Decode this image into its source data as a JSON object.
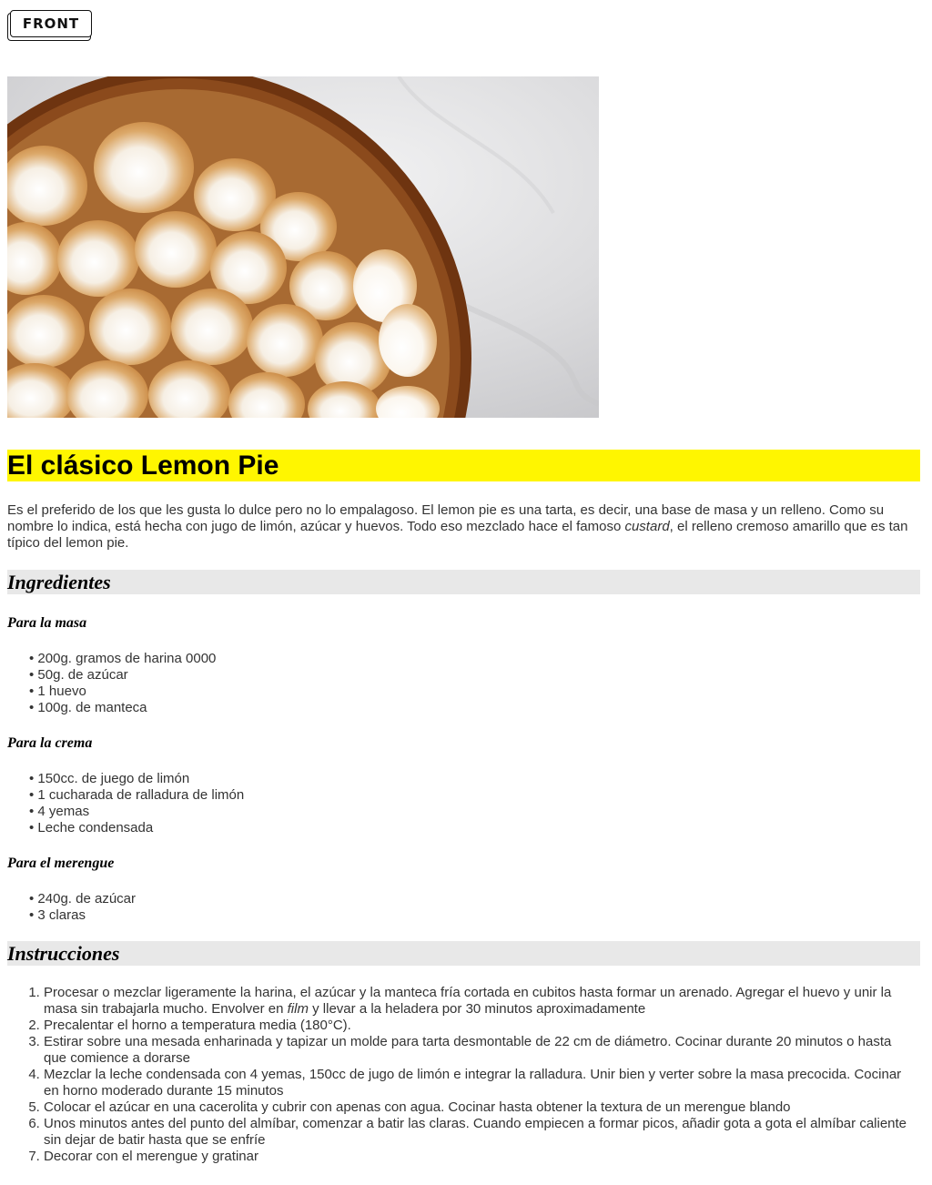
{
  "logo": {
    "text": "FRONT"
  },
  "hero": {
    "alt": "Lemon pie con merengue"
  },
  "recipe": {
    "title": "El clásico Lemon Pie",
    "intro_before": "Es el preferido de los que les gusta lo dulce pero no lo empalagoso. El lemon pie es una tarta, es decir, una base de masa y un relleno. Como su nombre lo indica, está hecha con jugo de limón, azúcar y huevos. Todo eso mezclado hace el famoso ",
    "intro_em": "custard",
    "intro_after": ", el relleno cremoso amarillo que es tan típico del lemon pie."
  },
  "ingredients": {
    "heading": "Ingredientes",
    "groups": [
      {
        "title": "Para la masa",
        "items": [
          "200g. gramos de harina 0000",
          "50g. de azúcar",
          "1 huevo",
          "100g. de manteca"
        ]
      },
      {
        "title": "Para la crema",
        "items": [
          "150cc. de juego de limón",
          "1 cucharada de ralladura de limón",
          "4 yemas",
          "Leche condensada"
        ]
      },
      {
        "title": "Para el merengue",
        "items": [
          "240g. de azúcar",
          "3 claras"
        ]
      }
    ]
  },
  "instructions": {
    "heading": "Instrucciones",
    "steps": [
      {
        "before": "Procesar o mezclar ligeramente la harina, el azúcar y la manteca fría cortada en cubitos hasta formar un arenado. Agregar el huevo y unir la masa sin trabajarla mucho. Envolver en ",
        "em": "film",
        "after": " y llevar a la heladera por 30 minutos aproximadamente"
      },
      {
        "before": "Precalentar el horno a temperatura media (180°C).",
        "em": "",
        "after": ""
      },
      {
        "before": "Estirar sobre una mesada enharinada y tapizar un molde para tarta desmontable de 22 cm de diámetro. Cocinar durante 20 minutos o hasta que comience a dorarse",
        "em": "",
        "after": ""
      },
      {
        "before": "Mezclar la leche condensada con 4 yemas, 150cc de jugo de limón e integrar la ralladura. Unir bien y verter sobre la masa precocida. Cocinar en horno moderado durante 15 minutos",
        "em": "",
        "after": ""
      },
      {
        "before": "Colocar el azúcar en una cacerolita y cubrir con apenas con agua. Cocinar hasta obtener la textura de un merengue blando",
        "em": "",
        "after": ""
      },
      {
        "before": "Unos minutos antes del punto del almíbar, comenzar a batir las claras. Cuando empiecen a formar picos, añadir gota a gota el almíbar caliente sin dejar de batir hasta que se enfríe",
        "em": "",
        "after": ""
      },
      {
        "before": "Decorar con el merengue y gratinar",
        "em": "",
        "after": ""
      }
    ]
  }
}
